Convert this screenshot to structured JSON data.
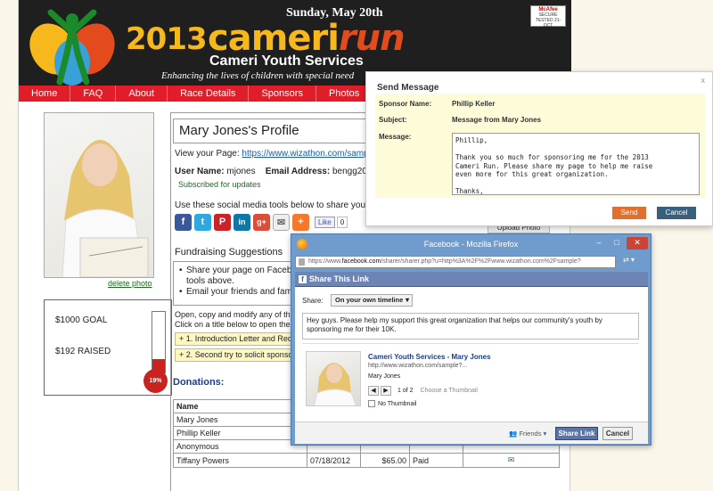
{
  "header": {
    "date": "Sunday, May 20th",
    "year": "2013",
    "brand_part1": "cameri",
    "brand_part2": "run",
    "org": "Cameri Youth Services",
    "tagline": "Enhancing the lives of children with special need",
    "mcafee_name": "McAfee",
    "mcafee_label": "SECURE",
    "mcafee_tested": "TESTED 21-OCT"
  },
  "nav": [
    "Home",
    "FAQ",
    "About",
    "Race Details",
    "Sponsors",
    "Photos"
  ],
  "sidebar": {
    "delete_photo": "delete photo",
    "goal": "$1000 GOAL",
    "raised": "$192 RAISED",
    "percent_label": "19%",
    "percent_value": 19
  },
  "profile": {
    "title": "Mary Jones's Profile",
    "view_page_label": "View your Page:",
    "view_page_url": "https://www.wizathon.com/samp",
    "user_name_label": "User Name:",
    "user_name": "mjones",
    "email_label": "Email Address:",
    "email": "bengg200",
    "subscribed": "Subscribed for updates",
    "social_text": "Use these social media tools below to share your",
    "like_label": "Like",
    "like_count": "0",
    "fundraising_title": "Fundraising Suggestions",
    "fund_items": [
      "Share your page on Faceboo",
      "tools above.",
      "Email your friends and famil"
    ],
    "letters_text_1": "Open, copy and modify any of the",
    "letters_text_2": "Click on a title below to open the",
    "letter_rows": [
      "+ 1. Introduction Letter and Requ",
      "+ 2. Second try to solicit sponsor"
    ],
    "upload_photo": "Upload Photo"
  },
  "donations": {
    "title": "Donations:",
    "total_label": "To",
    "header_name": "Name",
    "rows": [
      {
        "name": "Mary Jones",
        "date": "",
        "amount": "",
        "status": ""
      },
      {
        "name": "Phillip Keller",
        "date": "",
        "amount": "",
        "status": ""
      },
      {
        "name": "Anonymous",
        "date": "",
        "amount": "",
        "status": ""
      },
      {
        "name": "Tiffany Powers",
        "date": "07/18/2012",
        "amount": "$65.00",
        "status": "Paid"
      }
    ]
  },
  "send_message": {
    "header": "Send Message",
    "close": "x",
    "sponsor_label": "Sponsor Name:",
    "sponsor_value": "Phillip Keller",
    "subject_label": "Subject:",
    "subject_value": "Message from Mary Jones",
    "message_label": "Message:",
    "message_body": "Phillip,\n\nThank you so much for sponsoring me for the 2013\nCameri Run. Please share my page to help me raise\neven more for this great organization.\n\nThanks,",
    "send_label": "Send",
    "cancel_label": "Cancel"
  },
  "firefox": {
    "title": "Facebook - Mozilla Firefox",
    "url_prefix": "https://www.",
    "url_domain": "facebook.com",
    "url_rest": "/sharer/sharer.php?u=http%3A%2F%2Fwww.wizathon.com%2Fsample?",
    "close_glyph": "✕",
    "min_glyph": "–",
    "max_glyph": "□"
  },
  "facebook": {
    "bar_title": "Share This Link",
    "share_label": "Share:",
    "share_option": "On your own timeline",
    "share_text": "Hey guys. Please help my support this great organization that helps our community's youth by sponsoring me for their 10K.",
    "preview_title": "Cameri Youth Services - Mary Jones",
    "preview_url": "http://www.wizathon.com/sample?...",
    "preview_desc": "Mary Jones",
    "preview_of": "1 of 2",
    "preview_choose": "Choose a Thumbnail",
    "no_thumbnail": "No Thumbnail",
    "friends_label": "Friends",
    "share_link_label": "Share Link",
    "cancel_label": "Cancel"
  },
  "colors": {
    "nav_red": "#e11d2a",
    "brand_yellow": "#f6b81a",
    "brand_orange": "#e34a1c",
    "facebook_blue": "#3b5998",
    "send_orange": "#e07030",
    "cancel_slate": "#3a5f7a"
  }
}
